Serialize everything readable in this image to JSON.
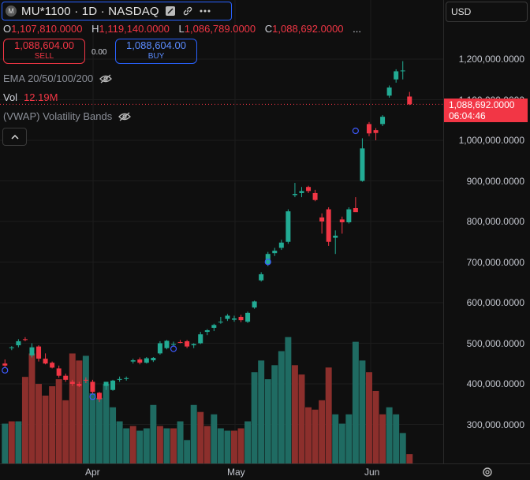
{
  "header": {
    "logo_letter": "M",
    "title": "MU*1100 · 1D · NASDAQ",
    "icons": [
      "fullscreen-icon",
      "link-icon",
      "more-icon"
    ]
  },
  "ohlc": {
    "open_key": "O",
    "open": "1,107,810.0000",
    "high_key": "H",
    "high": "1,119,140.0000",
    "low_key": "L",
    "low": "1,086,789.0000",
    "close_key": "C",
    "close": "1,088,692.0000",
    "more": "..."
  },
  "trade": {
    "sell_price": "1,088,604.00",
    "sell_label": "SELL",
    "spread": "0.00",
    "buy_price": "1,088,604.00",
    "buy_label": "BUY"
  },
  "indicators": {
    "ema": "EMA 20/50/100/200",
    "vol_label": "Vol",
    "vol_value": "12.19M",
    "vwap": "(VWAP) Volatility Bands"
  },
  "currency": "USD",
  "price_axis": {
    "ticks": [
      "1,200,000.0000",
      "1,100,000.0000",
      "1,000,000.0000",
      "900,000.0000",
      "800,000.0000",
      "700,000.0000",
      "600,000.0000",
      "500,000.0000",
      "400,000.0000",
      "300,000.0000"
    ],
    "last_price": "1,088,692.0000",
    "countdown": "06:04:46"
  },
  "time_axis": [
    "Apr",
    "May",
    "Jun"
  ],
  "colors": {
    "up": "#22ab94",
    "down": "#f23645",
    "vol_up": "#1f6b62",
    "vol_down": "#8c2f2c",
    "background": "#0f0f0f"
  },
  "chart_data": {
    "type": "candlestick",
    "ylim": [
      250000,
      1250000
    ],
    "candles": [
      {
        "o": 450000,
        "h": 460000,
        "l": 440000,
        "c": 445000
      },
      {
        "o": 488000,
        "h": 493000,
        "l": 483000,
        "c": 490000
      },
      {
        "o": 495000,
        "h": 510000,
        "l": 490000,
        "c": 505000
      },
      {
        "o": 510000,
        "h": 515000,
        "l": 505000,
        "c": 508000
      },
      {
        "o": 470000,
        "h": 500000,
        "l": 465000,
        "c": 490000
      },
      {
        "o": 492000,
        "h": 495000,
        "l": 455000,
        "c": 462000
      },
      {
        "o": 462000,
        "h": 475000,
        "l": 448000,
        "c": 450000
      },
      {
        "o": 452000,
        "h": 455000,
        "l": 438000,
        "c": 440000
      },
      {
        "o": 438000,
        "h": 445000,
        "l": 415000,
        "c": 420000
      },
      {
        "o": 420000,
        "h": 425000,
        "l": 405000,
        "c": 410000
      },
      {
        "o": 405000,
        "h": 410000,
        "l": 395000,
        "c": 400000
      },
      {
        "o": 400000,
        "h": 405000,
        "l": 392000,
        "c": 395000
      },
      {
        "o": 410000,
        "h": 416000,
        "l": 402000,
        "c": 408000
      },
      {
        "o": 405000,
        "h": 410000,
        "l": 375000,
        "c": 380000
      },
      {
        "o": 378000,
        "h": 380000,
        "l": 355000,
        "c": 362000
      },
      {
        "o": 395000,
        "h": 405000,
        "l": 385000,
        "c": 405000
      },
      {
        "o": 385000,
        "h": 410000,
        "l": 383000,
        "c": 408000
      },
      {
        "o": 410000,
        "h": 418000,
        "l": 405000,
        "c": 412000
      },
      {
        "o": 412000,
        "h": 418000,
        "l": 408000,
        "c": 414000
      },
      {
        "o": 455000,
        "h": 462000,
        "l": 450000,
        "c": 458000
      },
      {
        "o": 460000,
        "h": 465000,
        "l": 448000,
        "c": 452000
      },
      {
        "o": 452000,
        "h": 466000,
        "l": 450000,
        "c": 463000
      },
      {
        "o": 458000,
        "h": 466000,
        "l": 454000,
        "c": 464000
      },
      {
        "o": 475000,
        "h": 505000,
        "l": 472000,
        "c": 500000
      },
      {
        "o": 488000,
        "h": 508000,
        "l": 485000,
        "c": 506000
      },
      {
        "o": 496000,
        "h": 504000,
        "l": 492000,
        "c": 498000
      },
      {
        "o": 503000,
        "h": 508000,
        "l": 500000,
        "c": 502000
      },
      {
        "o": 505000,
        "h": 508000,
        "l": 488000,
        "c": 492000
      },
      {
        "o": 495000,
        "h": 500000,
        "l": 488000,
        "c": 498000
      },
      {
        "o": 500000,
        "h": 528000,
        "l": 498000,
        "c": 522000
      },
      {
        "o": 528000,
        "h": 535000,
        "l": 520000,
        "c": 532000
      },
      {
        "o": 538000,
        "h": 548000,
        "l": 530000,
        "c": 545000
      },
      {
        "o": 552000,
        "h": 565000,
        "l": 548000,
        "c": 553000
      },
      {
        "o": 560000,
        "h": 572000,
        "l": 555000,
        "c": 568000
      },
      {
        "o": 558000,
        "h": 568000,
        "l": 553000,
        "c": 561000
      },
      {
        "o": 565000,
        "h": 570000,
        "l": 552000,
        "c": 557000
      },
      {
        "o": 553000,
        "h": 578000,
        "l": 550000,
        "c": 575000
      },
      {
        "o": 588000,
        "h": 605000,
        "l": 585000,
        "c": 603000
      },
      {
        "o": 655000,
        "h": 675000,
        "l": 652000,
        "c": 670000
      },
      {
        "o": 695000,
        "h": 725000,
        "l": 690000,
        "c": 720000
      },
      {
        "o": 722000,
        "h": 735000,
        "l": 715000,
        "c": 728000
      },
      {
        "o": 735000,
        "h": 755000,
        "l": 730000,
        "c": 748000
      },
      {
        "o": 750000,
        "h": 830000,
        "l": 745000,
        "c": 825000
      },
      {
        "o": 865000,
        "h": 895000,
        "l": 860000,
        "c": 868000
      },
      {
        "o": 870000,
        "h": 885000,
        "l": 860000,
        "c": 875000
      },
      {
        "o": 885000,
        "h": 888000,
        "l": 870000,
        "c": 875000
      },
      {
        "o": 870000,
        "h": 878000,
        "l": 850000,
        "c": 853000
      },
      {
        "o": 810000,
        "h": 820000,
        "l": 770000,
        "c": 800000
      },
      {
        "o": 830000,
        "h": 835000,
        "l": 740000,
        "c": 750000
      },
      {
        "o": 760000,
        "h": 778000,
        "l": 720000,
        "c": 765000
      },
      {
        "o": 805000,
        "h": 812000,
        "l": 770000,
        "c": 798000
      },
      {
        "o": 798000,
        "h": 835000,
        "l": 795000,
        "c": 830000
      },
      {
        "o": 833000,
        "h": 860000,
        "l": 826000,
        "c": 823000
      },
      {
        "o": 900000,
        "h": 1005000,
        "l": 898000,
        "c": 980000
      },
      {
        "o": 1040000,
        "h": 1045000,
        "l": 1010000,
        "c": 1017000
      },
      {
        "o": 1025000,
        "h": 1030000,
        "l": 1000000,
        "c": 1018000
      },
      {
        "o": 1040000,
        "h": 1062000,
        "l": 1035000,
        "c": 1058000
      },
      {
        "o": 1110000,
        "h": 1135000,
        "l": 1105000,
        "c": 1130000
      },
      {
        "o": 1150000,
        "h": 1175000,
        "l": 1142000,
        "c": 1170000
      },
      {
        "o": 1170000,
        "h": 1195000,
        "l": 1150000,
        "c": 1172000
      },
      {
        "o": 1107810,
        "h": 1119140,
        "l": 1086789,
        "c": 1088692
      }
    ],
    "volume_ylim": [
      0,
      32000000
    ],
    "volumes": [
      {
        "v": 8500000,
        "up": true
      },
      {
        "v": 9000000,
        "up": false
      },
      {
        "v": 9000000,
        "up": true
      },
      {
        "v": 18500000,
        "up": false
      },
      {
        "v": 23500000,
        "up": false
      },
      {
        "v": 17000000,
        "up": false
      },
      {
        "v": 14500000,
        "up": false
      },
      {
        "v": 16500000,
        "up": false
      },
      {
        "v": 18000000,
        "up": false
      },
      {
        "v": 13500000,
        "up": false
      },
      {
        "v": 23500000,
        "up": false
      },
      {
        "v": 22000000,
        "up": false
      },
      {
        "v": 23000000,
        "up": true
      },
      {
        "v": 15000000,
        "up": true
      },
      {
        "v": 14000000,
        "up": true
      },
      {
        "v": 17000000,
        "up": true
      },
      {
        "v": 12000000,
        "up": true
      },
      {
        "v": 9000000,
        "up": true
      },
      {
        "v": 7500000,
        "up": true
      },
      {
        "v": 8000000,
        "up": false
      },
      {
        "v": 7000000,
        "up": true
      },
      {
        "v": 7500000,
        "up": true
      },
      {
        "v": 12500000,
        "up": true
      },
      {
        "v": 8000000,
        "up": false
      },
      {
        "v": 7500000,
        "up": true
      },
      {
        "v": 7500000,
        "up": false
      },
      {
        "v": 9000000,
        "up": true
      },
      {
        "v": 5000000,
        "up": true
      },
      {
        "v": 12500000,
        "up": true
      },
      {
        "v": 11000000,
        "up": false
      },
      {
        "v": 8000000,
        "up": false
      },
      {
        "v": 10500000,
        "up": true
      },
      {
        "v": 7500000,
        "up": true
      },
      {
        "v": 7000000,
        "up": true
      },
      {
        "v": 7000000,
        "up": false
      },
      {
        "v": 7500000,
        "up": false
      },
      {
        "v": 9000000,
        "up": true
      },
      {
        "v": 19500000,
        "up": true
      },
      {
        "v": 22000000,
        "up": true
      },
      {
        "v": 18000000,
        "up": true
      },
      {
        "v": 21000000,
        "up": true
      },
      {
        "v": 24000000,
        "up": true
      },
      {
        "v": 27000000,
        "up": true
      },
      {
        "v": 21000000,
        "up": false
      },
      {
        "v": 19000000,
        "up": false
      },
      {
        "v": 12000000,
        "up": false
      },
      {
        "v": 11500000,
        "up": false
      },
      {
        "v": 13500000,
        "up": false
      },
      {
        "v": 20500000,
        "up": false
      },
      {
        "v": 10500000,
        "up": true
      },
      {
        "v": 8500000,
        "up": true
      },
      {
        "v": 10500000,
        "up": true
      },
      {
        "v": 26000000,
        "up": true
      },
      {
        "v": 22000000,
        "up": true
      },
      {
        "v": 19500000,
        "up": false
      },
      {
        "v": 15500000,
        "up": false
      },
      {
        "v": 10500000,
        "up": false
      },
      {
        "v": 12000000,
        "up": true
      },
      {
        "v": 10500000,
        "up": true
      },
      {
        "v": 6500000,
        "up": true
      },
      {
        "v": 2000000,
        "up": false
      }
    ]
  }
}
